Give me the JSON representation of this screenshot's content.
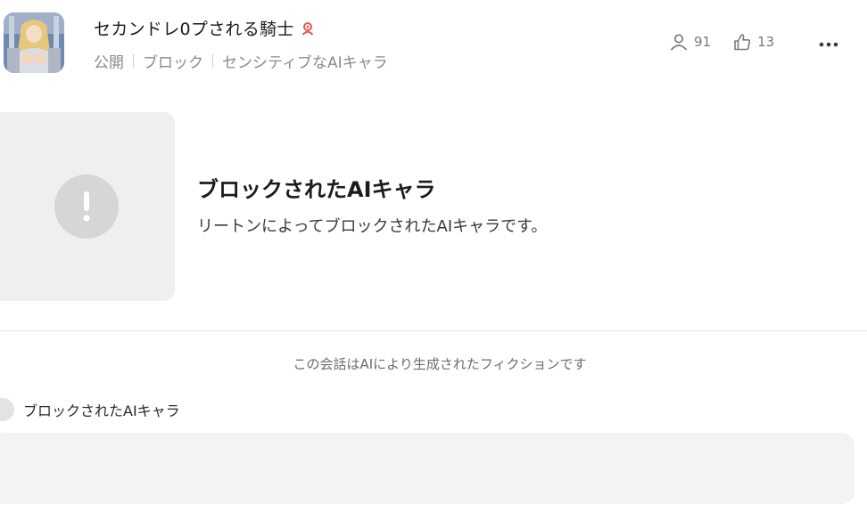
{
  "header": {
    "character_name": "セカンドレ0プされる騎士",
    "badge_icon": "person-badge-icon",
    "badge_color": "#e8584a",
    "tags": [
      "公開",
      "ブロック",
      "センシティブなAIキャラ"
    ],
    "stats": {
      "users_icon": "person-icon",
      "users_count": "91",
      "likes_icon": "thumbs-up-icon",
      "likes_count": "13"
    },
    "more_icon": "more-horizontal-icon"
  },
  "blocked_card": {
    "icon": "exclamation-circle-icon",
    "title": "ブロックされたAIキャラ",
    "description": "リートンによってブロックされたAIキャラです。"
  },
  "chat": {
    "disclaimer": "この会話はAIにより生成されたフィクションです",
    "speaker_name": "ブロックされたAIキャラ",
    "message_text": ""
  }
}
